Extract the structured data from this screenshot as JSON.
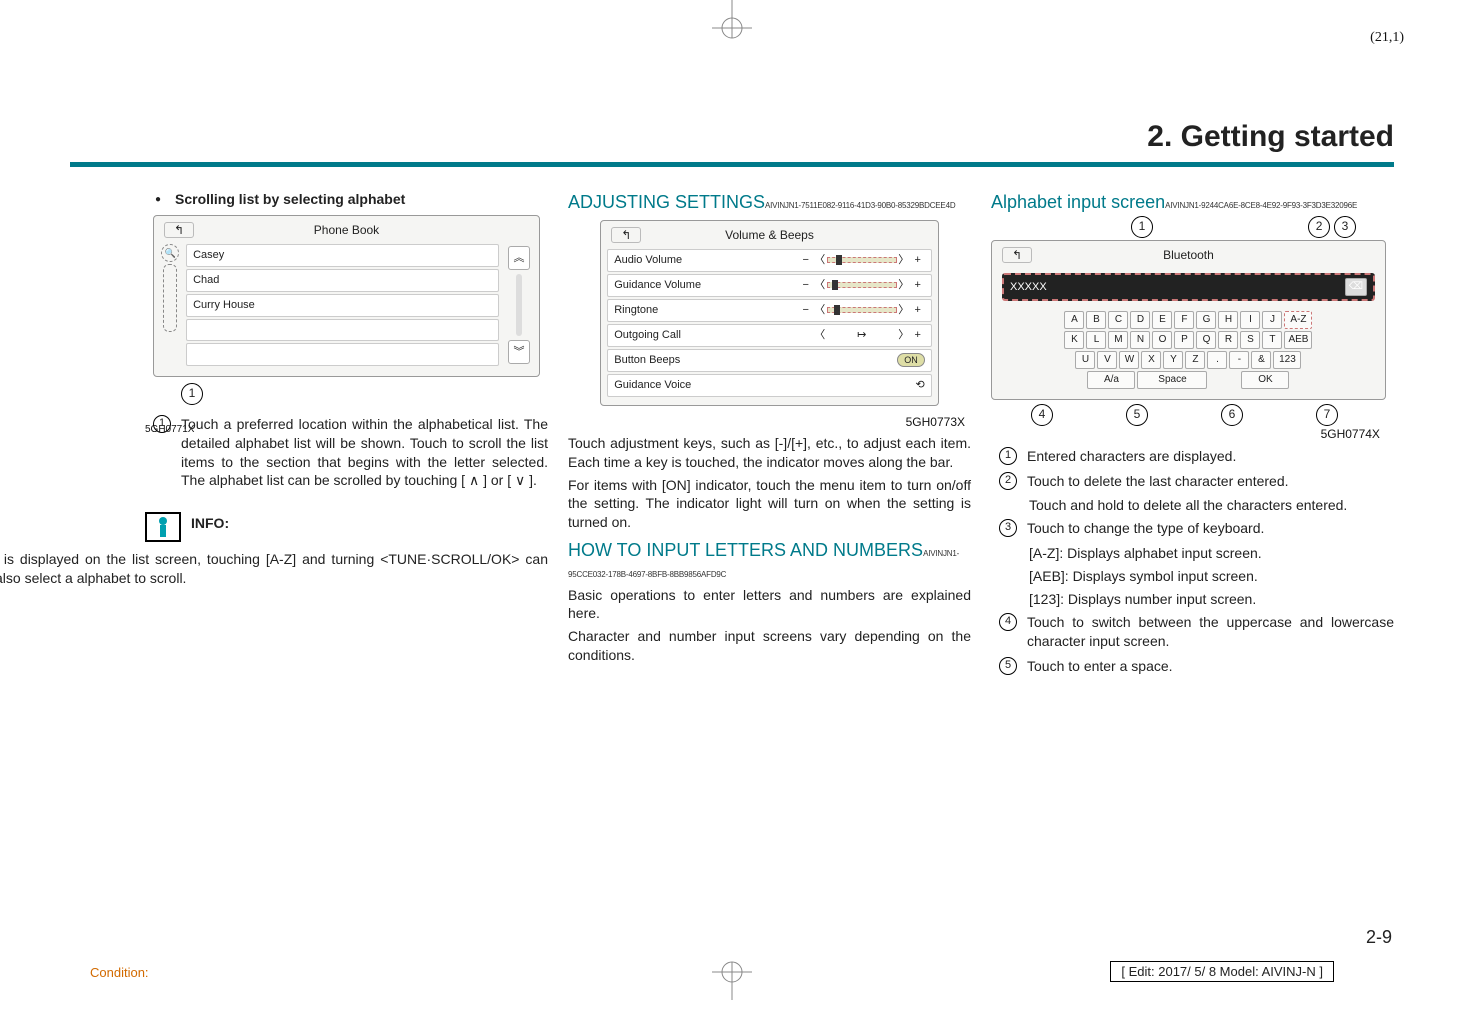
{
  "page_corner": "(21,1)",
  "chapter_title": "2. Getting started",
  "col1": {
    "bullet": "Scrolling list by selecting alphabet",
    "phonebook": {
      "title": "Phone Book",
      "items": [
        "Casey",
        "Chad",
        "Curry House"
      ],
      "callout": "1"
    },
    "fig_code": "5GH0771X",
    "num1": "Touch a preferred location within the alphabetical list. The detailed alphabet list will be shown. Touch to scroll the list items to the section that begins with the letter selected. The alphabet list can be scrolled by touching [ ∧ ] or [ ∨ ].",
    "info_label": "INFO:",
    "info_text": "When [A-Z] is displayed on the list screen, touching [A-Z] and turning <TUNE·SCROLL/OK> can also select a alphabet to scroll."
  },
  "col2": {
    "h1": "ADJUSTING SETTINGS",
    "h1_uid": "AIVINJN1-7511E082-9116-41D3-90B0-85329BDCEE4D",
    "vb_title": "Volume & Beeps",
    "vb_items": [
      "Audio Volume",
      "Guidance Volume",
      "Ringtone",
      "Outgoing Call",
      "Button Beeps",
      "Guidance Voice"
    ],
    "vb_on": "ON",
    "fig_code": "5GH0773X",
    "p1": "Touch adjustment keys, such as [-]/[+], etc., to adjust each item. Each time a key is touched, the indicator moves along the bar.",
    "p2": "For items with [ON] indicator, touch the menu item to turn on/off the setting. The indicator light will turn on when the setting is turned on.",
    "h2": "HOW TO INPUT LETTERS AND NUMBERS",
    "h2_uid": "AIVINJN1-95CCE032-178B-4697-8BFB-8BB9856AFD9C",
    "p3": "Basic operations to enter letters and numbers are explained here.",
    "p4": "Character and number input screens vary depending on the conditions."
  },
  "col3": {
    "h1": "Alphabet input screen",
    "h1_uid": "AIVINJN1-9244CA6E-8CE8-4E92-9F93-3F3D3E32096E",
    "bt_title": "Bluetooth",
    "bt_input": "XXXXX",
    "row1": [
      "A",
      "B",
      "C",
      "D",
      "E",
      "F",
      "G",
      "H",
      "I",
      "J",
      "A-Z"
    ],
    "row2": [
      "K",
      "L",
      "M",
      "N",
      "O",
      "P",
      "Q",
      "R",
      "S",
      "T",
      "AEB"
    ],
    "row3": [
      "U",
      "V",
      "W",
      "X",
      "Y",
      "Z",
      ".",
      "-",
      "&",
      "123"
    ],
    "row4_left": "A/a",
    "row4_mid": "Space",
    "row4_right": "OK",
    "callouts_top": [
      "1",
      "2",
      "3"
    ],
    "callouts_bottom": [
      "4",
      "5",
      "6",
      "7"
    ],
    "fig_code": "5GH0774X",
    "items": [
      "Entered characters are displayed.",
      "Touch to delete the last character entered.",
      "Touch to change the type of keyboard.",
      "Touch to switch between the uppercase and lowercase character input screen.",
      "Touch to enter a space."
    ],
    "item2_extra": "Touch and hold to delete all the characters entered.",
    "item3_lines": [
      "[A-Z]: Displays alphabet input screen.",
      "[AEB]: Displays symbol input screen.",
      "[123]: Displays number input screen."
    ]
  },
  "page_number": "2-9",
  "footer_edit": "[ Edit: 2017/ 5/ 8    Model:  AIVINJ-N ]",
  "condition": "Condition:"
}
